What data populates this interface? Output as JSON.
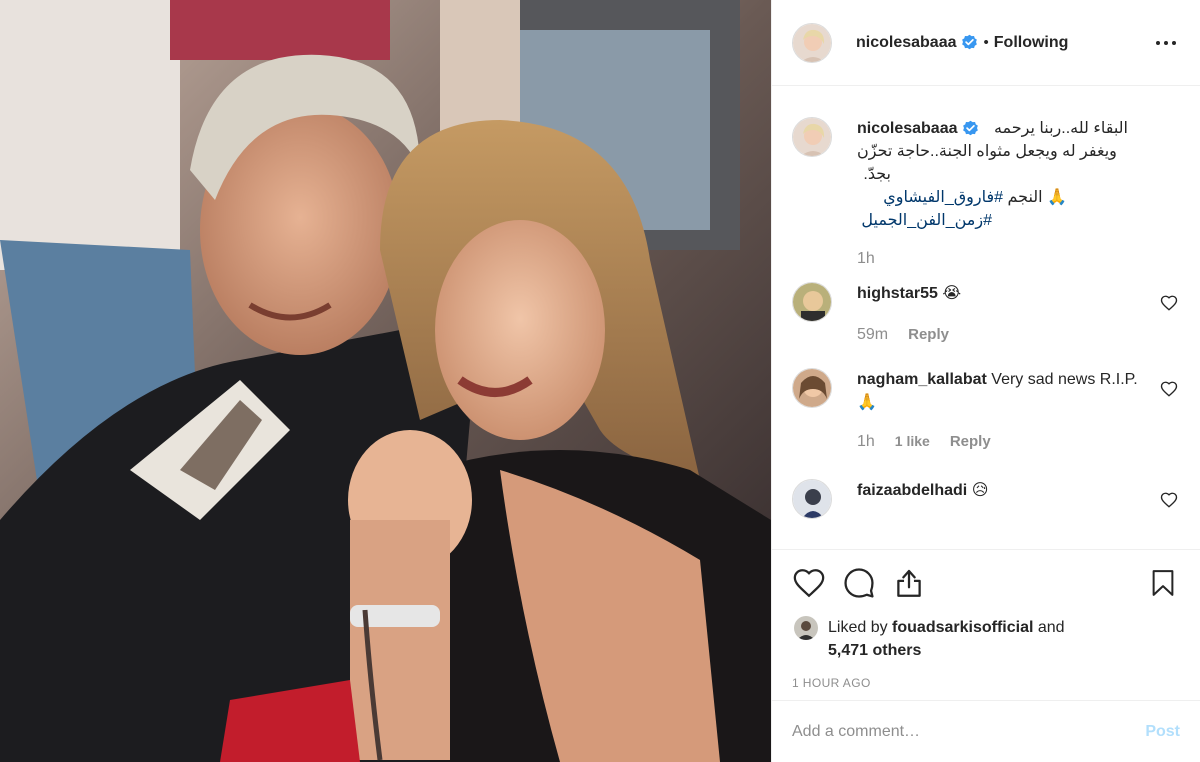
{
  "post": {
    "author": "nicolesabaaa",
    "follow_separator": "•",
    "follow_status": "Following",
    "caption": {
      "line1": "البقاء لله..ربنا يرحمه",
      "line2": "ويغفر له ويجعل مثواه الجنة..حاجة تحزّن",
      "line3": "بجدّ.",
      "line4_prefix": "🙏 النجم",
      "hashtag1": "#فاروق_الفيشاوي",
      "hashtag2": "#زمن_الفن_الجميل",
      "time": "1h"
    },
    "comments": [
      {
        "user": "highstar55",
        "text": "😭",
        "time": "59m",
        "likes": "",
        "reply": "Reply"
      },
      {
        "user": "nagham_kallabat",
        "text": "Very sad news R.I.P. 🙏",
        "time": "1h",
        "likes": "1 like",
        "reply": "Reply"
      },
      {
        "user": "faizaabdelhadi",
        "text": "😥",
        "time": "",
        "likes": "",
        "reply": ""
      }
    ],
    "liked_by_prefix": "Liked by",
    "liked_by_user": "fouadsarkisofficial",
    "liked_by_and": "and",
    "liked_by_others": "5,471 others",
    "timestamp": "1 HOUR AGO"
  },
  "add_comment": {
    "placeholder": "Add a comment…",
    "post_label": "Post"
  },
  "icons": {
    "more": "more-options-icon",
    "verified": "verified-badge-icon",
    "like": "heart-icon",
    "comment": "comment-bubble-icon",
    "share": "share-icon",
    "save": "bookmark-icon"
  },
  "colors": {
    "verified": "#3897f0",
    "hashtag": "#00376b",
    "muted": "#8e8e8e",
    "post_disabled": "#b2dffc"
  }
}
